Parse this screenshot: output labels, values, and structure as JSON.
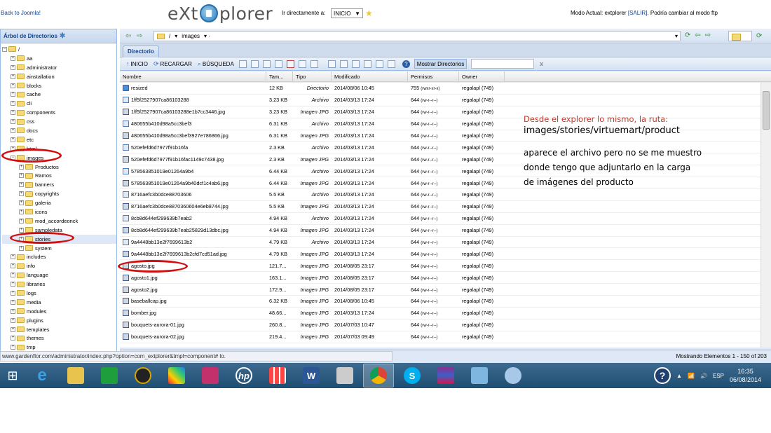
{
  "topbar": {
    "back_link": "Back to Joomla!",
    "logo_left": "eXt",
    "logo_right": "plorer",
    "goto_label": "Ir directamente a:",
    "goto_value": "INICIO",
    "mode_prefix": "Modo Actual: extplorer",
    "mode_link": "[SALIR]",
    "mode_suffix": ". Podría cambiar al modo ftp"
  },
  "tree": {
    "title": "Árbol de Directorios",
    "root": "/",
    "items": [
      {
        "label": "aa",
        "depth": 1
      },
      {
        "label": "administrator",
        "depth": 1
      },
      {
        "label": "ainstallation",
        "depth": 1
      },
      {
        "label": "blocks",
        "depth": 1
      },
      {
        "label": "cache",
        "depth": 1
      },
      {
        "label": "cli",
        "depth": 1
      },
      {
        "label": "components",
        "depth": 1
      },
      {
        "label": "css",
        "depth": 1
      },
      {
        "label": "docs",
        "depth": 1
      },
      {
        "label": "etc",
        "depth": 1
      },
      {
        "label": "html",
        "depth": 1
      },
      {
        "label": "images",
        "depth": 1
      },
      {
        "label": "Productos",
        "depth": 2
      },
      {
        "label": "Ramos",
        "depth": 2
      },
      {
        "label": "banners",
        "depth": 2
      },
      {
        "label": "copyrights",
        "depth": 2
      },
      {
        "label": "galeria",
        "depth": 2
      },
      {
        "label": "icons",
        "depth": 2
      },
      {
        "label": "mod_accordeonck",
        "depth": 2
      },
      {
        "label": "sampledata",
        "depth": 2
      },
      {
        "label": "stories",
        "depth": 2
      },
      {
        "label": "system",
        "depth": 2
      },
      {
        "label": "includes",
        "depth": 1
      },
      {
        "label": "info",
        "depth": 1
      },
      {
        "label": "language",
        "depth": 1
      },
      {
        "label": "libraries",
        "depth": 1
      },
      {
        "label": "logs",
        "depth": 1
      },
      {
        "label": "media",
        "depth": 1
      },
      {
        "label": "modules",
        "depth": 1
      },
      {
        "label": "plugins",
        "depth": 1
      },
      {
        "label": "templates",
        "depth": 1
      },
      {
        "label": "themes",
        "depth": 1
      },
      {
        "label": "tmp",
        "depth": 1
      }
    ]
  },
  "pathbar": {
    "root": "/",
    "current": "images"
  },
  "tabs": {
    "directory": "Directorio"
  },
  "toolbar": {
    "home": "INICIO",
    "reload": "RECARGAR",
    "search": "BÚSQUEDA",
    "show_dirs": "Mostrar Directorios",
    "clear": "x"
  },
  "grid": {
    "headers": [
      "Nombre",
      "Tam...",
      "Tipo",
      "Modificado",
      "Permisos",
      "Owner"
    ],
    "rows": [
      {
        "name": "resized",
        "size": "12 KB",
        "type": "Directorio",
        "modified": "2014/08/06 10:45",
        "perm": "755",
        "perm_detail": "(rwxr-xr-x)",
        "owner": "regalapl (749)",
        "kind": "dir"
      },
      {
        "name": "1ff5f2527907ca86103288",
        "size": "3.23 KB",
        "type": "Archivo",
        "modified": "2014/03/13 17:24",
        "perm": "644",
        "perm_detail": "(rw-r--r--)",
        "owner": "regalapl (749)",
        "kind": "file"
      },
      {
        "name": "1ff5f2527907ca86103288e1b7cc3446.jpg",
        "size": "3.23 KB",
        "type": "Imagen JPG",
        "modified": "2014/03/13 17:24",
        "perm": "644",
        "perm_detail": "(rw-r--r--)",
        "owner": "regalapl (749)",
        "kind": "img"
      },
      {
        "name": "480655b410d98a5cc3bef3",
        "size": "6.31 KB",
        "type": "Archivo",
        "modified": "2014/03/13 17:24",
        "perm": "644",
        "perm_detail": "(rw-r--r--)",
        "owner": "regalapl (749)",
        "kind": "file"
      },
      {
        "name": "480655b410d98a5cc3bef3927e786866.jpg",
        "size": "6.31 KB",
        "type": "Imagen JPG",
        "modified": "2014/03/13 17:24",
        "perm": "644",
        "perm_detail": "(rw-r--r--)",
        "owner": "regalapl (749)",
        "kind": "img"
      },
      {
        "name": "520efefd6d7977f91b16fa",
        "size": "2.3 KB",
        "type": "Archivo",
        "modified": "2014/03/13 17:24",
        "perm": "644",
        "perm_detail": "(rw-r--r--)",
        "owner": "regalapl (749)",
        "kind": "file"
      },
      {
        "name": "520efefd6d7977f91b16fac1149c7438.jpg",
        "size": "2.3 KB",
        "type": "Imagen JPG",
        "modified": "2014/03/13 17:24",
        "perm": "644",
        "perm_detail": "(rw-r--r--)",
        "owner": "regalapl (749)",
        "kind": "img"
      },
      {
        "name": "578563851019e01264a9b4",
        "size": "6.44 KB",
        "type": "Archivo",
        "modified": "2014/03/13 17:24",
        "perm": "644",
        "perm_detail": "(rw-r--r--)",
        "owner": "regalapl (749)",
        "kind": "file"
      },
      {
        "name": "578563851019e01264a9b40dcf1c4ab6.jpg",
        "size": "6.44 KB",
        "type": "Imagen JPG",
        "modified": "2014/03/13 17:24",
        "perm": "644",
        "perm_detail": "(rw-r--r--)",
        "owner": "regalapl (749)",
        "kind": "img"
      },
      {
        "name": "8716aefc3b0dce88703606",
        "size": "5.5 KB",
        "type": "Archivo",
        "modified": "2014/03/13 17:24",
        "perm": "644",
        "perm_detail": "(rw-r--r--)",
        "owner": "regalapl (749)",
        "kind": "file"
      },
      {
        "name": "8716aefc3b0dce8870360604e6eb8744.jpg",
        "size": "5.5 KB",
        "type": "Imagen JPG",
        "modified": "2014/03/13 17:24",
        "perm": "644",
        "perm_detail": "(rw-r--r--)",
        "owner": "regalapl (749)",
        "kind": "img"
      },
      {
        "name": "8cb8d644ef299639b7eab2",
        "size": "4.94 KB",
        "type": "Archivo",
        "modified": "2014/03/13 17:24",
        "perm": "644",
        "perm_detail": "(rw-r--r--)",
        "owner": "regalapl (749)",
        "kind": "file"
      },
      {
        "name": "8cb8d644ef299639b7eab25829d13dbc.jpg",
        "size": "4.94 KB",
        "type": "Imagen JPG",
        "modified": "2014/03/13 17:24",
        "perm": "644",
        "perm_detail": "(rw-r--r--)",
        "owner": "regalapl (749)",
        "kind": "img"
      },
      {
        "name": "9a4448bb13e2f7699613b2",
        "size": "4.79 KB",
        "type": "Archivo",
        "modified": "2014/03/13 17:24",
        "perm": "644",
        "perm_detail": "(rw-r--r--)",
        "owner": "regalapl (749)",
        "kind": "file"
      },
      {
        "name": "9a4448bb13e2f7699613b2cfd7cd51ad.jpg",
        "size": "4.79 KB",
        "type": "Imagen JPG",
        "modified": "2014/03/13 17:24",
        "perm": "644",
        "perm_detail": "(rw-r--r--)",
        "owner": "regalapl (749)",
        "kind": "img"
      },
      {
        "name": "agosto.jpg",
        "size": "121.7...",
        "type": "Imagen JPG",
        "modified": "2014/08/05 23:17",
        "perm": "644",
        "perm_detail": "(rw-r--r--)",
        "owner": "regalapl (749)",
        "kind": "img"
      },
      {
        "name": "agosto1.jpg",
        "size": "163.1...",
        "type": "Imagen JPG",
        "modified": "2014/08/05 23:17",
        "perm": "644",
        "perm_detail": "(rw-r--r--)",
        "owner": "regalapl (749)",
        "kind": "img"
      },
      {
        "name": "agosto2.jpg",
        "size": "172.9...",
        "type": "Imagen JPG",
        "modified": "2014/08/05 23:17",
        "perm": "644",
        "perm_detail": "(rw-r--r--)",
        "owner": "regalapl (749)",
        "kind": "img"
      },
      {
        "name": "baseballcap.jpg",
        "size": "6.32 KB",
        "type": "Imagen JPG",
        "modified": "2014/08/06 10:45",
        "perm": "644",
        "perm_detail": "(rw-r--r--)",
        "owner": "regalapl (749)",
        "kind": "img"
      },
      {
        "name": "bomber.jpg",
        "size": "48.66...",
        "type": "Imagen JPG",
        "modified": "2014/03/13 17:24",
        "perm": "644",
        "perm_detail": "(rw-r--r--)",
        "owner": "regalapl (749)",
        "kind": "img"
      },
      {
        "name": "bouquets-aurora-01.jpg",
        "size": "260.8...",
        "type": "Imagen JPG",
        "modified": "2014/07/03 10:47",
        "perm": "644",
        "perm_detail": "(rw-r--r--)",
        "owner": "regalapl (749)",
        "kind": "img"
      },
      {
        "name": "bouquets-aurora-02.jpg",
        "size": "219.4...",
        "type": "Imagen JPG",
        "modified": "2014/07/03 09:49",
        "perm": "644",
        "perm_detail": "(rw-r--r--)",
        "owner": "regalapl (749)",
        "kind": "img"
      }
    ]
  },
  "status": {
    "count": "Mostrando Elementos 1 - 150 of 203",
    "url": "www.gardenflor.com/administrator/index.php?option=com_extplorer&tmpl=component#",
    "url_tail": "lo."
  },
  "annotation": {
    "line1": "Desde el explorer lo mismo, la ruta:",
    "line2": "images/stories/virtuemart/product",
    "para_1": "aparece el archivo pero no se me muestro",
    "para_2": "donde tengo que adjuntarlo en la carga",
    "para_3": "de imágenes del producto"
  },
  "taskbar": {
    "lang": "ESP",
    "time": "16:35",
    "date": "06/08/2014"
  },
  "colors": {
    "header_blue": "#15428b",
    "annotation_red": "#c0392b",
    "circle_red": "#d01010",
    "taskbar": "#2a5a80"
  }
}
